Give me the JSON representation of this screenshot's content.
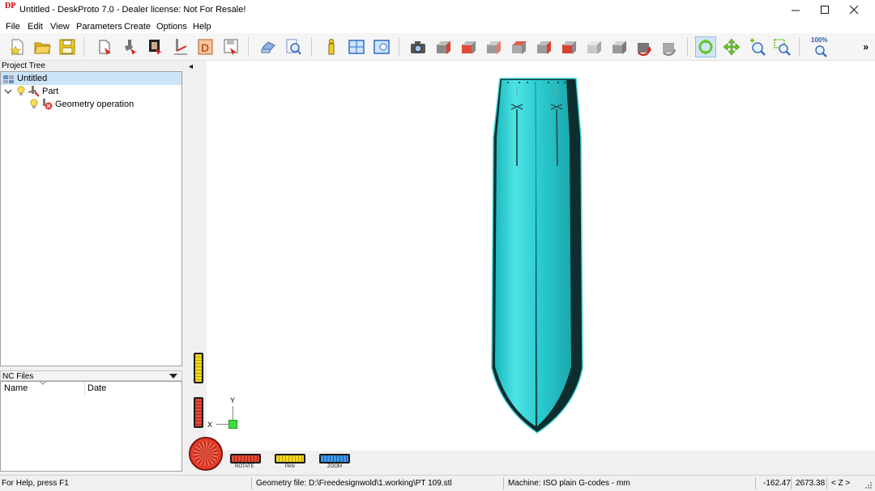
{
  "window": {
    "title": "Untitled - DeskProto 7.0 - Dealer license: Not For Resale!",
    "icon_text": "DP"
  },
  "menu": [
    "File",
    "Edit",
    "View",
    "Parameters",
    "Create",
    "Options",
    "Help"
  ],
  "toolbar": {
    "zoom_label": "100%",
    "more": "»"
  },
  "project_tree": {
    "header": "Project Tree",
    "root": "Untitled",
    "part": "Part",
    "operation": "Geometry operation"
  },
  "nc_files": {
    "header": "NC Files",
    "columns": [
      "Name",
      "Date"
    ]
  },
  "viewport": {
    "axis_y": "Y",
    "axis_x": "X",
    "controls": [
      "ROTATE",
      "PAN",
      "ZOOM"
    ],
    "collapse_arrow": "◂"
  },
  "colors": {
    "model": "#3fd6d9",
    "model_dark": "#0d2d2f",
    "rotate": "#d83a2a",
    "pan": "#e8d21a",
    "zoom": "#2f8fe0",
    "selected": "#cce4f7"
  },
  "status": {
    "help": "For Help, press F1",
    "geometry_file": "Geometry file: D:\\Freedesignwold\\1.working\\PT 109.stl",
    "machine": "Machine: ISO plain G-codes - mm",
    "coord_x": "-162.47",
    "coord_y": "2673.38",
    "view_axis": "< Z >"
  }
}
